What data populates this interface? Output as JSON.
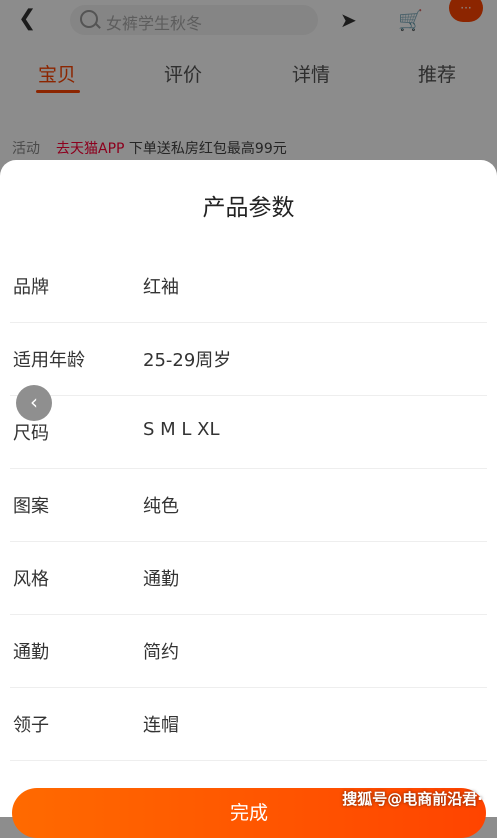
{
  "top": {
    "search_placeholder": "女裤学生秋冬",
    "more_badge": "···"
  },
  "tabs": [
    {
      "label": "宝贝"
    },
    {
      "label": "评价"
    },
    {
      "label": "详情"
    },
    {
      "label": "推荐"
    }
  ],
  "promo": {
    "label": "活动",
    "tmall": "去天猫APP",
    "text": "下单送私房红包最高99元"
  },
  "sheet": {
    "title": "产品参数",
    "rows": [
      {
        "key": "品牌",
        "value": "红袖"
      },
      {
        "key": "适用年龄",
        "value": "25-29周岁"
      },
      {
        "key": "尺码",
        "value": "S M L XL"
      },
      {
        "key": "图案",
        "value": "纯色"
      },
      {
        "key": "风格",
        "value": "通勤"
      },
      {
        "key": "通勤",
        "value": "简约"
      },
      {
        "key": "领子",
        "value": "连帽"
      }
    ],
    "done_label": "完成"
  },
  "watermark": "搜狐号@电商前沿君·",
  "colors": {
    "accent": "#ff4400",
    "tmall": "#ff0036"
  }
}
